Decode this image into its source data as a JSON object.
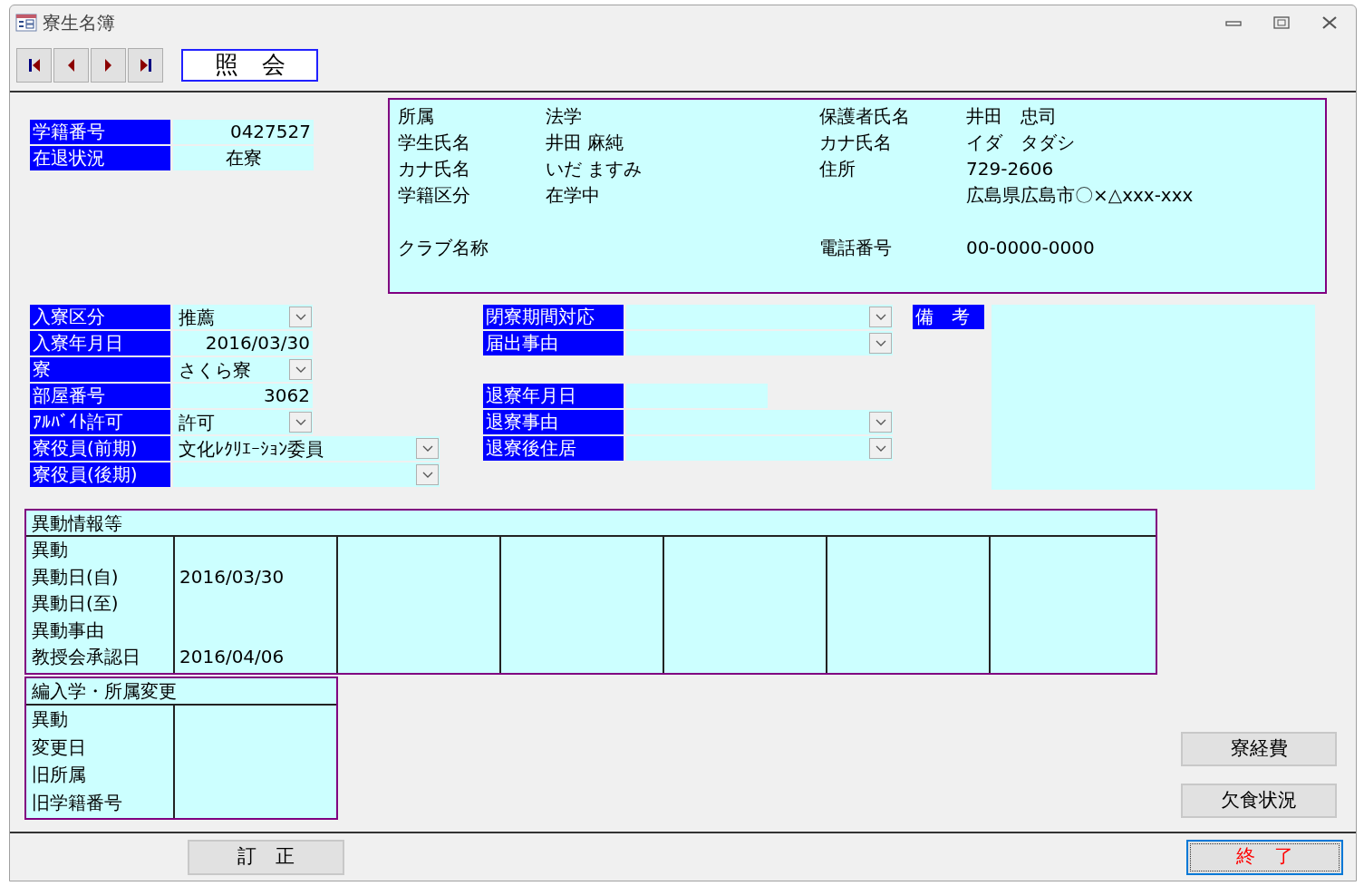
{
  "window": {
    "title": "寮生名簿"
  },
  "navigation": [
    {
      "kind": "first"
    },
    {
      "kind": "previous"
    },
    {
      "kind": "next"
    },
    {
      "kind": "last"
    }
  ],
  "mode_label": "照　会",
  "status_fields": [
    {
      "label": "学籍番号",
      "value": "0427527",
      "kind": "number"
    },
    {
      "label": "在退状況",
      "value": "在寮",
      "kind": "text"
    }
  ],
  "info_panel": {
    "rows": [
      {
        "label": "所属",
        "value": "法学",
        "label2": "保護者氏名",
        "value2": "井田　忠司"
      },
      {
        "label": "学生氏名",
        "value": "井田 麻純",
        "label2": "カナ氏名",
        "value2": "イダ　タダシ"
      },
      {
        "label": "カナ氏名",
        "value": "いだ ますみ",
        "label2": "住所",
        "value2": "729-2606"
      },
      {
        "label": "学籍区分",
        "value": "在学中",
        "value2": "広島県広島市〇×△xxx-xxx"
      },
      {
        "label": "クラブ名称",
        "label2": "電話番号",
        "value2": "00-0000-0000"
      }
    ]
  },
  "admission_fields": [
    {
      "label": "入寮区分",
      "value": "推薦",
      "kind": "dropdown"
    },
    {
      "label": "入寮年月日",
      "value": "2016/03/30",
      "kind": "text"
    },
    {
      "label": "寮",
      "value": "さくら寮",
      "kind": "dropdown"
    },
    {
      "label": "部屋番号",
      "value": "3062",
      "kind": "text"
    },
    {
      "label": "ｱﾙﾊﾞｲﾄ許可",
      "value": "許可",
      "kind": "dropdown"
    },
    {
      "label": "寮役員(前期)",
      "value": "文化ﾚｸﾘｴｰｼｮﾝ委員",
      "kind": "dropdown"
    },
    {
      "label": "寮役員(後期)",
      "kind": "dropdown"
    }
  ],
  "leaving_fields": [
    {
      "label": "閉寮期間対応",
      "kind": "dropdown"
    },
    {
      "label": "届出事由",
      "kind": "dropdown"
    },
    {
      "label": "退寮年月日",
      "kind": "text"
    },
    {
      "label": "退寮事由",
      "kind": "dropdown"
    },
    {
      "label": "退寮後住居",
      "kind": "dropdown"
    }
  ],
  "remarks": {
    "label": "備　考"
  },
  "history": {
    "title": "異動情報等",
    "row_labels": [
      "異動",
      "異動日(自)",
      "異動日(至)",
      "異動事由",
      "教授会承認日"
    ],
    "entries": [
      {
        "date_from": "2016/03/30",
        "approval_date": "2016/04/06"
      }
    ]
  },
  "transfer": {
    "title": "編入学・所属変更",
    "row_labels": [
      "異動",
      "変更日",
      "旧所属",
      "旧学籍番号"
    ]
  },
  "side_buttons": [
    {
      "label": "寮経費"
    },
    {
      "label": "欠食状況"
    }
  ],
  "footer_buttons": [
    {
      "label": "訂　正",
      "color": "#000000",
      "focused": false
    },
    {
      "label": "終　了",
      "color": "#ff0000",
      "focused": true
    }
  ]
}
